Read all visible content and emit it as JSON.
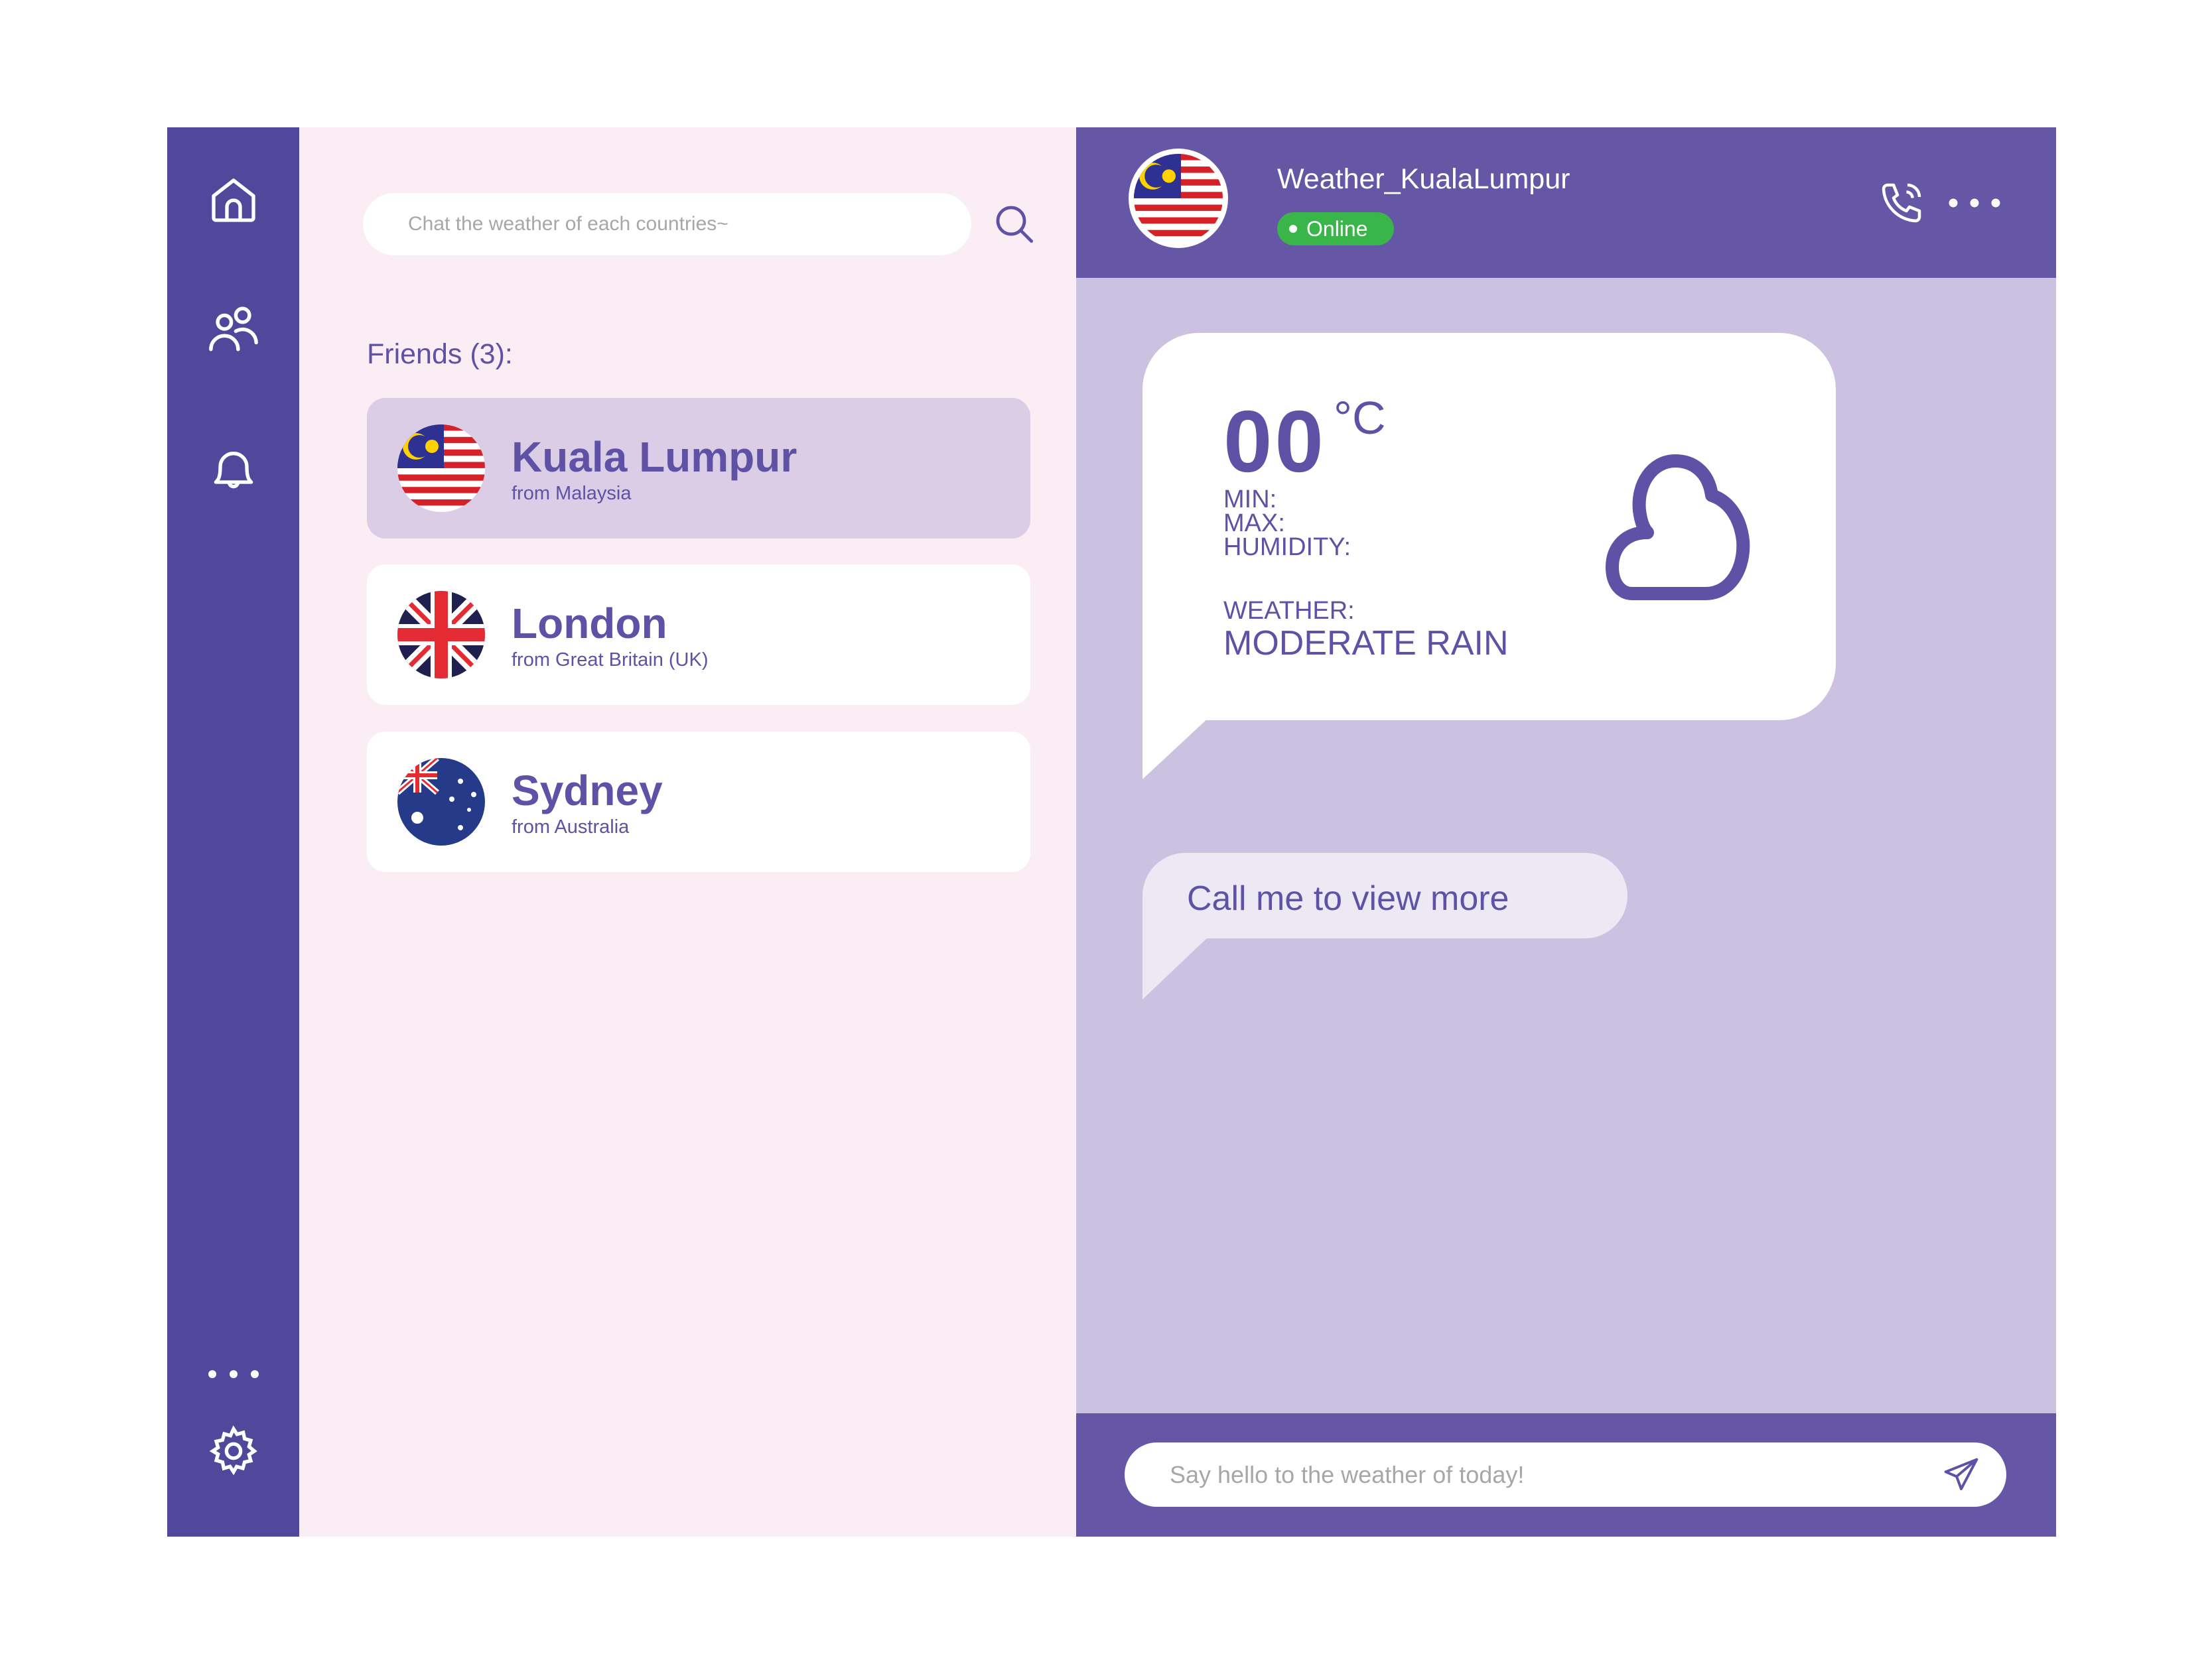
{
  "sidebar": {
    "items": [
      {
        "icon": "home-icon"
      },
      {
        "icon": "friends-icon"
      },
      {
        "icon": "bell-icon"
      },
      {
        "icon": "more-icon"
      },
      {
        "icon": "gear-icon"
      }
    ]
  },
  "search": {
    "placeholder": "Chat the weather of each countries~",
    "icon": "search-icon"
  },
  "friends": {
    "label": "Friends (3):",
    "items": [
      {
        "name": "Kuala Lumpur",
        "from": "from Malaysia",
        "flag": "malaysia-flag",
        "active": true
      },
      {
        "name": "London",
        "from": "from Great Britain (UK)",
        "flag": "uk-flag",
        "active": false
      },
      {
        "name": "Sydney",
        "from": "from Australia",
        "flag": "australia-flag",
        "active": false
      }
    ]
  },
  "chat": {
    "title": "Weather_KualaLumpur",
    "status": "Online",
    "weather": {
      "temp": "00",
      "unit": "°C",
      "min": "MIN:",
      "max": "MAX:",
      "humidity": "HUMIDITY:",
      "weather_label": "WEATHER:",
      "weather_value": "MODERATE RAIN",
      "icon": "cloud-icon"
    },
    "message": "Call me to view more",
    "input_placeholder": "Say hello to the weather of today!"
  },
  "colors": {
    "sidebar": "#51479B",
    "header": "#6557A6",
    "chat_bg": "#CBC1E0",
    "accent": "#5F52A6",
    "online": "#39B54A",
    "list_bg": "#FAEDF3"
  }
}
